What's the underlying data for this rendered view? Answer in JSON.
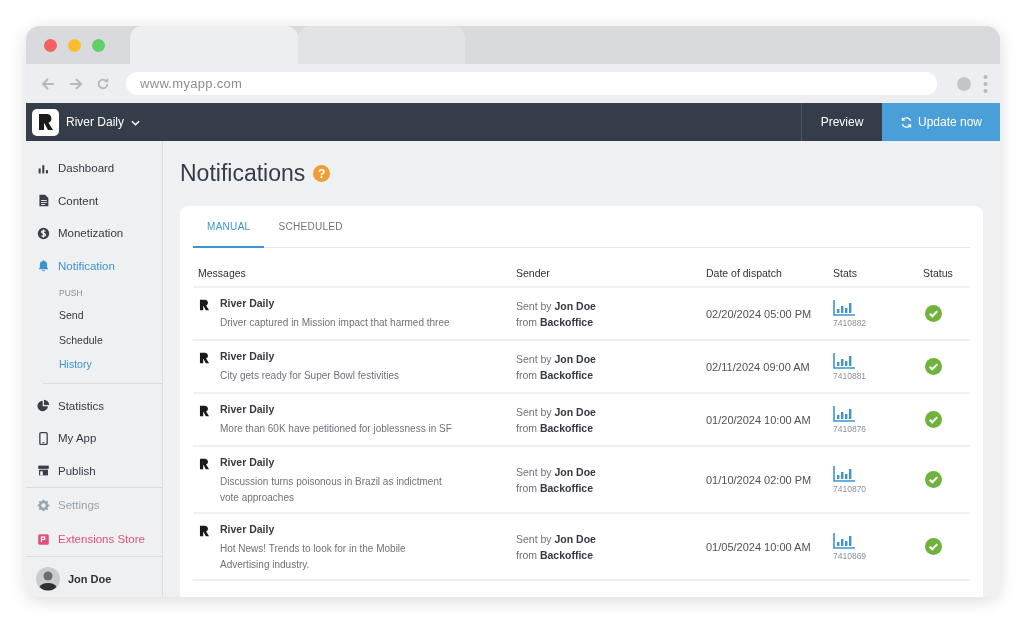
{
  "browser": {
    "url": "www.myapp.com"
  },
  "app": {
    "name": "River Daily",
    "preview": "Preview",
    "update": "Update now"
  },
  "sidebar": {
    "items": [
      {
        "kind": "nav",
        "label": "Dashboard",
        "selected": false
      },
      {
        "kind": "nav",
        "label": "Content",
        "selected": false
      },
      {
        "kind": "nav",
        "label": "Monetization",
        "selected": false
      },
      {
        "kind": "nav",
        "label": "Notification",
        "selected": true
      },
      {
        "kind": "section",
        "label": "PUSH"
      },
      {
        "kind": "sub",
        "label": "Send",
        "selected": false
      },
      {
        "kind": "sub",
        "label": "Schedule",
        "selected": false
      },
      {
        "kind": "sub",
        "label": "History",
        "selected": true
      },
      {
        "kind": "divider"
      },
      {
        "kind": "nav",
        "label": "Statistics",
        "selected": false
      },
      {
        "kind": "nav",
        "label": "My App",
        "selected": false
      },
      {
        "kind": "nav",
        "label": "Publish",
        "selected": false
      },
      {
        "kind": "rule"
      },
      {
        "kind": "muted",
        "label": "Settings"
      },
      {
        "kind": "accent",
        "label": "Extensions Store",
        "color": "#e0507a"
      }
    ],
    "user": {
      "name": "Jon Doe"
    }
  },
  "page": {
    "title": "Notifications",
    "help": "?"
  },
  "tabs": [
    {
      "label": "MANUAL",
      "selected": true
    },
    {
      "label": "SCHEDULED",
      "selected": false
    }
  ],
  "table": {
    "columns": [
      "Messages",
      "Sender",
      "Date of dispatch",
      "Stats",
      "Status"
    ],
    "rows": [
      {
        "source": "River Daily",
        "message": "Driver captured in Mission impact that harmed three",
        "sender": "Sent by **Jon Doe**",
        "origin": "from **Backoffice**",
        "date": "02/20/2024 05:00 PM",
        "stats": "7410882",
        "delivered": true
      },
      {
        "source": "River Daily",
        "message": "City gets ready for Super Bowl festivities",
        "sender": "Sent by **Jon Doe**",
        "origin": "from **Backoffice**",
        "date": "02/11/2024 09:00 AM",
        "stats": "7410881",
        "delivered": true
      },
      {
        "source": "River Daily",
        "message": "More than 60K have petitioned for joblessness in SF",
        "sender": "Sent by **Jon Doe**",
        "origin": "from **Backoffice**",
        "date": "01/20/2024 10:00 AM",
        "stats": "7410876",
        "delivered": true
      },
      {
        "source": "River Daily",
        "message": "Discussion turns poisonous in Brazil as indictment vote approaches",
        "sender": "Sent by **Jon Doe**",
        "origin": "from **Backoffice**",
        "date": "01/10/2024 02:00 PM",
        "stats": "7410870",
        "delivered": true
      },
      {
        "source": "River Daily",
        "message": "Hot News! Trends to look for in the Mobile Advertising industry.",
        "sender": "Sent by **Jon Doe**",
        "origin": "from **Backoffice**",
        "date": "01/05/2024 10:00 AM",
        "stats": "7410869",
        "delivered": true
      }
    ]
  }
}
